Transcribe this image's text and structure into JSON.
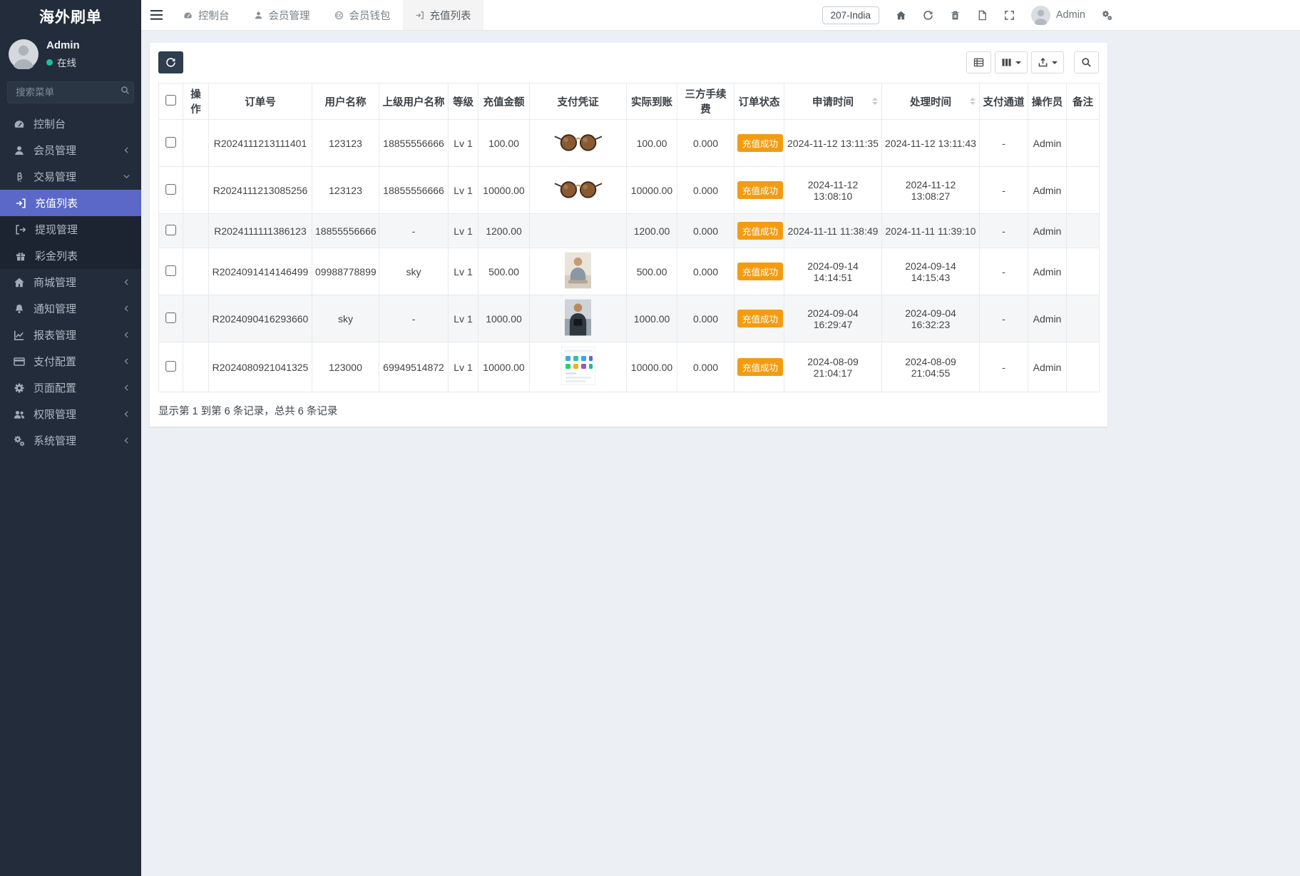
{
  "app": {
    "title": "海外刷单"
  },
  "sidebar": {
    "user": {
      "name": "Admin",
      "status": "在线"
    },
    "search_placeholder": "搜索菜单",
    "items": [
      {
        "label": "控制台",
        "icon": "dashboard-icon"
      },
      {
        "label": "会员管理",
        "icon": "member-icon",
        "state": "collapsed"
      },
      {
        "label": "交易管理",
        "icon": "bitcoin-icon",
        "state": "expanded"
      },
      {
        "label": "充值列表",
        "icon": "recharge-icon",
        "active": true
      },
      {
        "label": "提现管理",
        "icon": "withdraw-icon"
      },
      {
        "label": "彩金列表",
        "icon": "bonus-icon"
      },
      {
        "label": "商城管理",
        "icon": "mall-icon",
        "state": "collapsed"
      },
      {
        "label": "通知管理",
        "icon": "notice-icon",
        "state": "collapsed"
      },
      {
        "label": "报表管理",
        "icon": "report-icon",
        "state": "collapsed"
      },
      {
        "label": "支付配置",
        "icon": "payment-icon",
        "state": "collapsed"
      },
      {
        "label": "页面配置",
        "icon": "page-icon",
        "state": "collapsed"
      },
      {
        "label": "权限管理",
        "icon": "permission-icon",
        "state": "collapsed"
      },
      {
        "label": "系统管理",
        "icon": "system-icon",
        "state": "collapsed"
      }
    ]
  },
  "topbar": {
    "tabs": [
      {
        "label": "控制台",
        "icon": "dashboard-icon"
      },
      {
        "label": "会员管理",
        "icon": "member-icon"
      },
      {
        "label": "会员钱包",
        "icon": "wallet-icon"
      },
      {
        "label": "充值列表",
        "icon": "recharge-icon",
        "active": true
      }
    ],
    "region_label": "207-India",
    "icons": [
      "home-icon",
      "refresh-icon",
      "trash-icon",
      "file-icon",
      "expand-icon"
    ],
    "user_name": "Admin"
  },
  "toolbar": {
    "buttons": [
      "refresh",
      "toggle-view",
      "columns",
      "export",
      "search"
    ]
  },
  "table": {
    "headers": [
      "操作",
      "订单号",
      "用户名称",
      "上级用户名称",
      "等级",
      "充值金额",
      "支付凭证",
      "实际到账",
      "三方手续费",
      "订单状态",
      "申请时间",
      "处理时间",
      "支付通道",
      "操作员",
      "备注"
    ],
    "rows": [
      {
        "operation": "",
        "order_no": "R2024111213111401",
        "username": "123123",
        "parent": "18855556666",
        "level": "Lv 1",
        "amount": "100.00",
        "voucher": "sunglasses-photo",
        "received": "100.00",
        "fee": "0.000",
        "status": "充值成功",
        "apply_time": "2024-11-12 13:11:35",
        "process_time": "2024-11-12 13:11:43",
        "channel": "-",
        "operator": "Admin",
        "remark": ""
      },
      {
        "operation": "",
        "order_no": "R2024111213085256",
        "username": "123123",
        "parent": "18855556666",
        "level": "Lv 1",
        "amount": "10000.00",
        "voucher": "sunglasses-photo",
        "received": "10000.00",
        "fee": "0.000",
        "status": "充值成功",
        "apply_time": "2024-11-12 13:08:10",
        "process_time": "2024-11-12 13:08:27",
        "channel": "-",
        "operator": "Admin",
        "remark": ""
      },
      {
        "operation": "",
        "order_no": "R2024111111386123",
        "username": "18855556666",
        "parent": "-",
        "level": "Lv 1",
        "amount": "1200.00",
        "voucher": "",
        "received": "1200.00",
        "fee": "0.000",
        "status": "充值成功",
        "apply_time": "2024-11-11 11:38:49",
        "process_time": "2024-11-11 11:39:10",
        "channel": "-",
        "operator": "Admin",
        "remark": ""
      },
      {
        "operation": "",
        "order_no": "R2024091414146499",
        "username": "09988778899",
        "parent": "sky",
        "level": "Lv 1",
        "amount": "500.00",
        "voucher": "person-photo",
        "received": "500.00",
        "fee": "0.000",
        "status": "充值成功",
        "apply_time": "2024-09-14 14:14:51",
        "process_time": "2024-09-14 14:15:43",
        "channel": "-",
        "operator": "Admin",
        "remark": ""
      },
      {
        "operation": "",
        "order_no": "R2024090416293660",
        "username": "sky",
        "parent": "-",
        "level": "Lv 1",
        "amount": "1000.00",
        "voucher": "person-photo-dark",
        "received": "1000.00",
        "fee": "0.000",
        "status": "充值成功",
        "apply_time": "2024-09-04 16:29:47",
        "process_time": "2024-09-04 16:32:23",
        "channel": "-",
        "operator": "Admin",
        "remark": ""
      },
      {
        "operation": "",
        "order_no": "R2024080921041325",
        "username": "123000",
        "parent": "69949514872",
        "level": "Lv 1",
        "amount": "10000.00",
        "voucher": "app-screenshot",
        "received": "10000.00",
        "fee": "0.000",
        "status": "充值成功",
        "apply_time": "2024-08-09 21:04:17",
        "process_time": "2024-08-09 21:04:55",
        "channel": "-",
        "operator": "Admin",
        "remark": ""
      }
    ],
    "footer": "显示第 1 到第 6 条记录，总共 6 条记录"
  },
  "colors": {
    "accent": "#5b68c8",
    "status_badge": "#f39c12",
    "online": "#18c29c",
    "sidebar_bg": "#222c3a"
  }
}
